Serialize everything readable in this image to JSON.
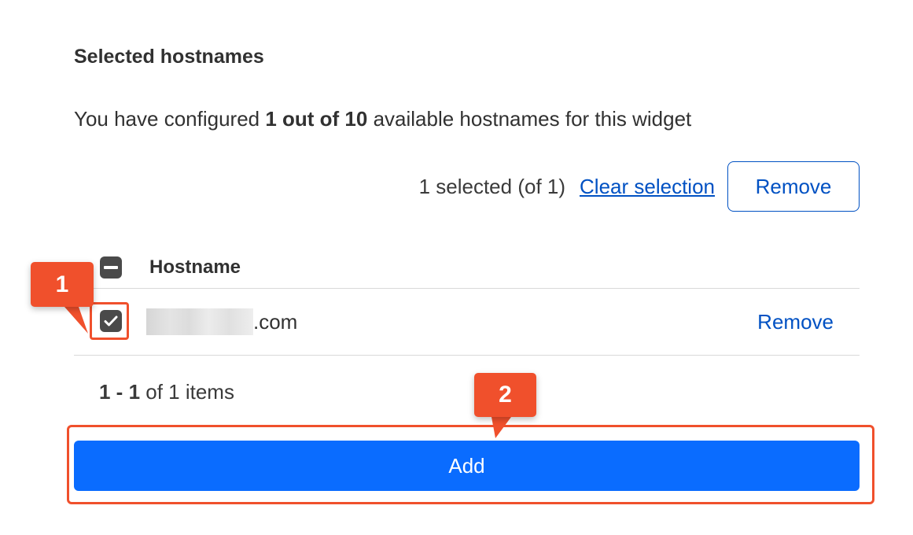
{
  "section": {
    "title": "Selected hostnames",
    "summary_prefix": "You have configured ",
    "summary_bold": "1 out of 10",
    "summary_suffix": " available hostnames for this widget"
  },
  "selection_bar": {
    "selected_count": "1 selected (of 1)",
    "clear_link": "Clear selection",
    "remove_label": "Remove"
  },
  "table": {
    "column_header": "Hostname",
    "rows": [
      {
        "hostname_suffix": ".com",
        "remove_label": "Remove",
        "checked": true
      }
    ]
  },
  "pagination": {
    "range": "1 - 1",
    "suffix": " of 1 items"
  },
  "add_button": {
    "label": "Add"
  },
  "annotations": {
    "callout_1": "1",
    "callout_2": "2",
    "color": "#f0502c"
  },
  "colors": {
    "link": "#0051c3",
    "primary_button": "#0a6cff",
    "checkbox": "#4a4a4a"
  },
  "icons": {
    "header_checkbox": "minus-checkbox-icon",
    "row_checkbox": "checkmark-checkbox-icon"
  }
}
